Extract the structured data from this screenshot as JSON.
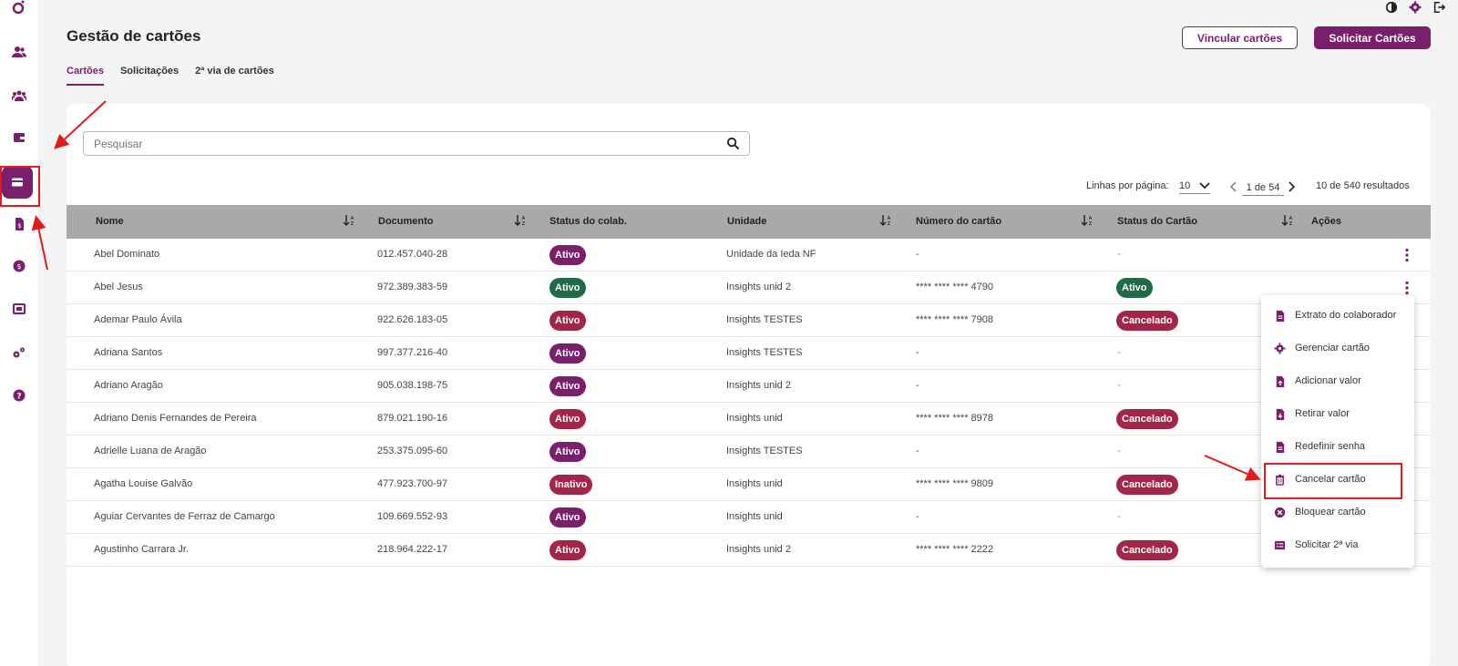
{
  "header": {
    "title": "Gestão de cartões",
    "link_button": "Vincular cartões",
    "request_button": "Solicitar Cartões"
  },
  "tabs": [
    {
      "label": "Cartões",
      "active": true
    },
    {
      "label": "Solicitações",
      "active": false
    },
    {
      "label": "2ª via de cartões",
      "active": false
    }
  ],
  "search": {
    "placeholder": "Pesquisar",
    "value": ""
  },
  "pagination": {
    "rows_label": "Linhas por página:",
    "rows_value": "10",
    "page": "1 de 54",
    "results": "10 de 540 resultados"
  },
  "table": {
    "headers": [
      "Nome",
      "Documento",
      "Status do colab.",
      "Unidade",
      "Número do cartão",
      "Status do Cartão",
      "Ações"
    ],
    "rows": [
      {
        "nome": "Abel Dominato",
        "doc": "012.457.040-28",
        "status": "Ativo",
        "status_color": "#7a1f6e",
        "unidade": "Unidade da Ieda NF",
        "cartao": "-",
        "cartao_status": "-",
        "cartao_color": ""
      },
      {
        "nome": "Abel Jesus",
        "doc": "972.389.383-59",
        "status": "Ativo",
        "status_color": "#1e6b45",
        "unidade": "Insights unid 2",
        "cartao": "**** **** **** 4790",
        "cartao_status": "Ativo",
        "cartao_color": "#1e6b45"
      },
      {
        "nome": "Ademar Paulo Ávila",
        "doc": "922.626.183-05",
        "status": "Ativo",
        "status_color": "#a3254a",
        "unidade": "Insights TESTES",
        "cartao": "**** **** **** 7908",
        "cartao_status": "Cancelado",
        "cartao_color": "#a3254a"
      },
      {
        "nome": "Adriana Santos",
        "doc": "997.377.216-40",
        "status": "Ativo",
        "status_color": "#7a1f6e",
        "unidade": "Insights TESTES",
        "cartao": "-",
        "cartao_status": "-",
        "cartao_color": ""
      },
      {
        "nome": "Adriano Aragão",
        "doc": "905.038.198-75",
        "status": "Ativo",
        "status_color": "#7a1f6e",
        "unidade": "Insights unid 2",
        "cartao": "-",
        "cartao_status": "-",
        "cartao_color": ""
      },
      {
        "nome": "Adriano Denis Fernandes de Pereira",
        "doc": "879.021.190-16",
        "status": "Ativo",
        "status_color": "#a3254a",
        "unidade": "Insights unid",
        "cartao": "**** **** **** 8978",
        "cartao_status": "Cancelado",
        "cartao_color": "#a3254a"
      },
      {
        "nome": "Adrielle Luana de Aragão",
        "doc": "253.375.095-60",
        "status": "Ativo",
        "status_color": "#7a1f6e",
        "unidade": "Insights TESTES",
        "cartao": "-",
        "cartao_status": "-",
        "cartao_color": ""
      },
      {
        "nome": "Agatha Louise Galvão",
        "doc": "477.923.700-97",
        "status": "Inativo",
        "status_color": "#a3254a",
        "unidade": "Insights unid",
        "cartao": "**** **** **** 9809",
        "cartao_status": "Cancelado",
        "cartao_color": "#a3254a"
      },
      {
        "nome": "Aguiar Cervantes de Ferraz de Camargo",
        "doc": "109.669.552-93",
        "status": "Ativo",
        "status_color": "#7a1f6e",
        "unidade": "Insights unid",
        "cartao": "-",
        "cartao_status": "-",
        "cartao_color": ""
      },
      {
        "nome": "Agustinho Carrara Jr.",
        "doc": "218.964.222-17",
        "status": "Ativo",
        "status_color": "#a3254a",
        "unidade": "Insights unid 2",
        "cartao": "**** **** **** 2222",
        "cartao_status": "Cancelado",
        "cartao_color": "#a3254a"
      }
    ]
  },
  "menu": {
    "items": [
      {
        "label": "Extrato do colaborador",
        "icon": "document-icon"
      },
      {
        "label": "Gerenciar cartão",
        "icon": "gear-icon"
      },
      {
        "label": "Adicionar valor",
        "icon": "upload-file-icon"
      },
      {
        "label": "Retirar valor",
        "icon": "download-file-icon"
      },
      {
        "label": "Redefinir senha",
        "icon": "document-icon"
      },
      {
        "label": "Cancelar cartão",
        "icon": "trash-icon"
      },
      {
        "label": "Bloquear cartão",
        "icon": "block-icon"
      },
      {
        "label": "Solicitar 2ª via",
        "icon": "list-icon"
      }
    ]
  },
  "colors": {
    "brand": "#7a1f6e",
    "active_green": "#1e6b45",
    "cancel_red": "#a3254a",
    "annotation": "#e01b1b"
  }
}
